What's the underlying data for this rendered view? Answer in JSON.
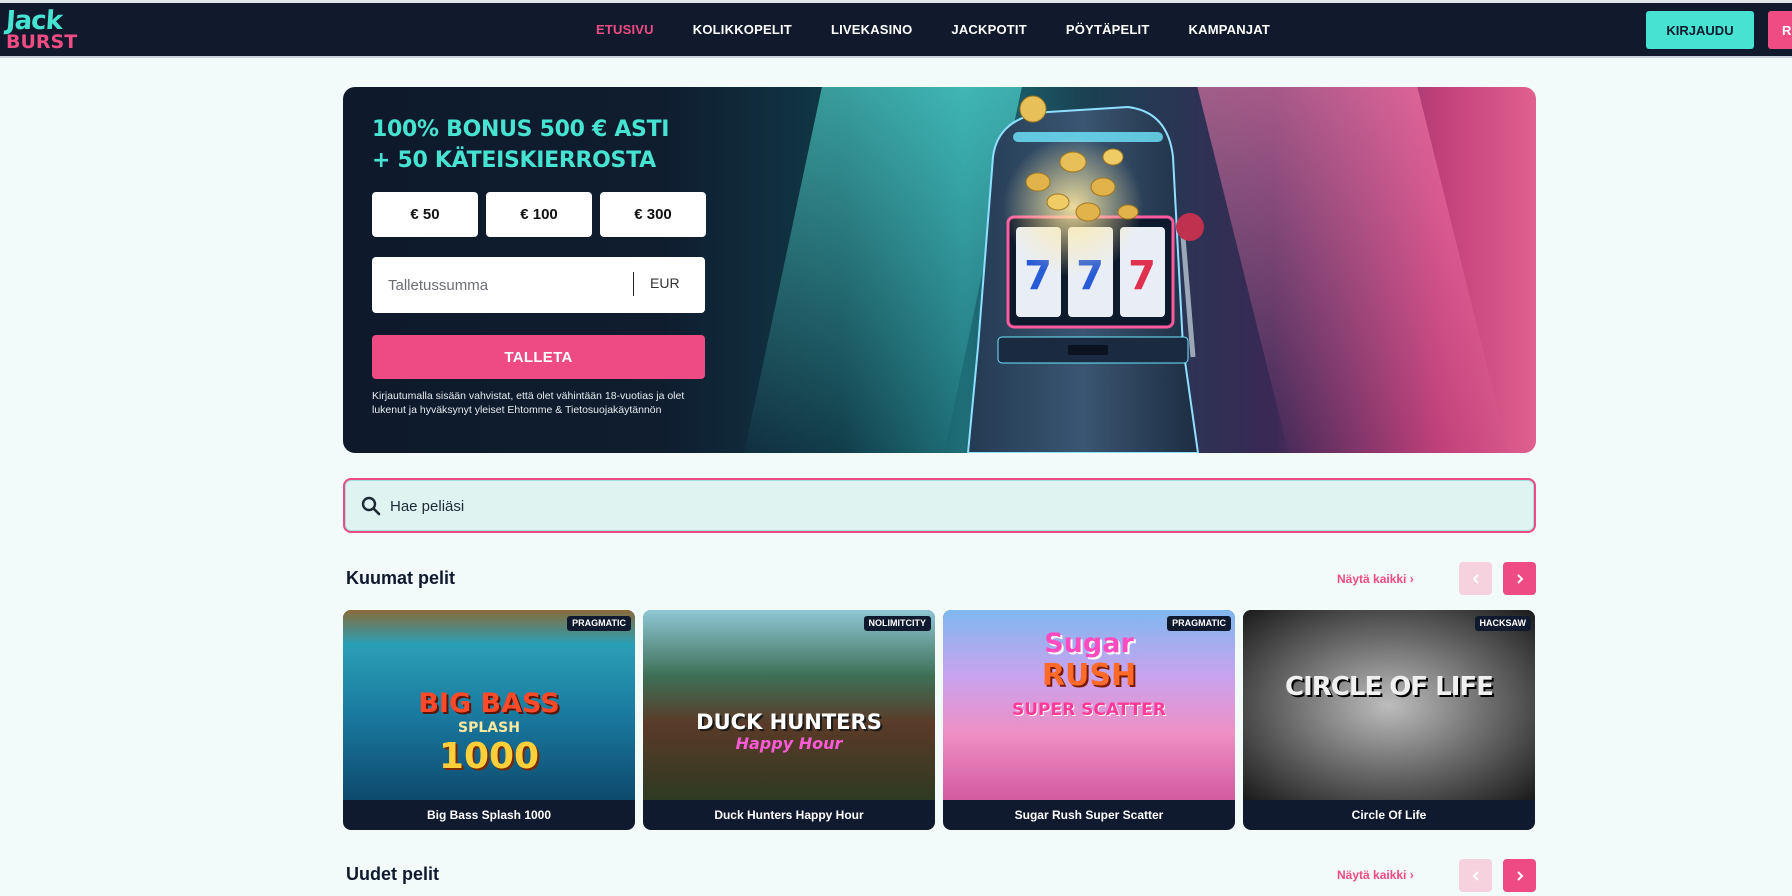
{
  "header": {
    "logo_top": "Jack",
    "logo_bottom": "BURST",
    "nav": [
      "ETUSIVU",
      "KOLIKKOPELIT",
      "LIVEKASINO",
      "JACKPOTIT",
      "PÖYTÄPELIT",
      "KAMPANJAT"
    ],
    "active_nav": "ETUSIVU",
    "login_label": "KIRJAUDU",
    "register_label": "R"
  },
  "hero": {
    "title_line1": "100% BONUS 500 € ASTI",
    "title_line2": "+ 50 KÄTEISKIERROSTA",
    "amounts": [
      "€ 50",
      "€ 100",
      "€ 300"
    ],
    "deposit_placeholder": "Talletussumma",
    "currency": "EUR",
    "deposit_button": "TALLETA",
    "legal_text": "Kirjautumalla sisään vahvistat, että olet vähintään 18-vuotias ja olet lukenut ja hyväksynyt yleiset Ehtomme & Tietosuojakäytännön"
  },
  "search": {
    "placeholder": "Hae peliäsi"
  },
  "hot_games": {
    "title": "Kuumat pelit",
    "see_all": "Näytä kaikki ›",
    "games": [
      {
        "name": "Big Bass Splash 1000",
        "provider": "PRAGMATIC",
        "art_line1": "BIG BASS",
        "art_line2": "SPLASH",
        "art_line3": "1000"
      },
      {
        "name": "Duck Hunters Happy Hour",
        "provider": "NOLIMITCITY",
        "art_line1": "DUCK HUNTERS",
        "art_line2": "Happy Hour",
        "art_line3": ""
      },
      {
        "name": "Sugar Rush Super Scatter",
        "provider": "PRAGMATIC",
        "art_line1": "Sugar",
        "art_line2": "RUSH",
        "art_line3": "SUPER SCATTER"
      },
      {
        "name": "Circle Of Life",
        "provider": "HACKSAW",
        "art_line1": "CIRCLE OF LIFE",
        "art_line2": "",
        "art_line3": ""
      }
    ]
  },
  "new_games": {
    "title": "Uudet pelit",
    "see_all": "Näytä kaikki ›"
  },
  "colors": {
    "accent_teal": "#46e3d3",
    "accent_pink": "#ee4a83",
    "nav_bg": "#101a2c",
    "page_bg": "#f2fbfa"
  },
  "icons": {
    "search": "search-icon",
    "prev": "chevron-left-icon",
    "next": "chevron-right-icon"
  }
}
